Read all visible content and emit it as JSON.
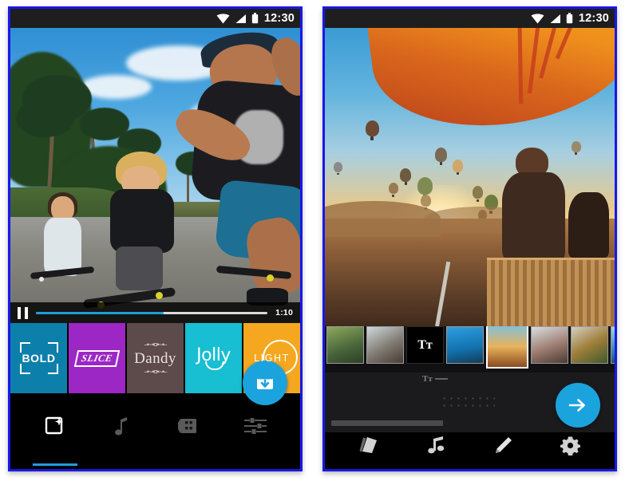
{
  "page": {
    "background": "#ffffff",
    "frame_border_color": "#1818e8",
    "accent_blue": "#1ba3dd"
  },
  "phones": [
    {
      "id": "left",
      "name": "video-editor-filters-screen",
      "status_bar": {
        "time": "12:30",
        "icons": [
          "wifi-icon",
          "signal-icon",
          "battery-icon"
        ]
      },
      "preview": {
        "name": "skateboarding-video-preview",
        "alt": "Man with cap filming a boy and woman on skateboards on a palm-lined road"
      },
      "player": {
        "state_icon": "pause-icon",
        "progress_percent": 55,
        "time_remaining": "1:10",
        "progress_color": "#1d9fdb",
        "track_color": "#d9d9d9"
      },
      "filters": [
        {
          "label": "BOLD",
          "color": "#0d7fab",
          "mark": "bracket-frame"
        },
        {
          "label": "SLICE",
          "color": "#9c27c4",
          "mark": "skew-box"
        },
        {
          "label": "Dandy",
          "color": "#5d4a4a",
          "mark": "ornament"
        },
        {
          "label": "Jolly",
          "color": "#18bed1",
          "mark": "smile"
        },
        {
          "label": "LIGHT",
          "color": "#f5a81f",
          "mark": "circle-ring"
        }
      ],
      "fab": {
        "icon": "save-to-box-icon",
        "color": "#1ba3dd"
      },
      "nav": [
        {
          "name": "nav-effects",
          "icon": "photo-sparkle-icon",
          "active": true
        },
        {
          "name": "nav-music",
          "icon": "music-note-icon",
          "active": false
        },
        {
          "name": "nav-clips",
          "icon": "film-strip-icon",
          "active": false
        },
        {
          "name": "nav-adjust",
          "icon": "sliders-icon",
          "active": false
        }
      ]
    },
    {
      "id": "right",
      "name": "story-timeline-editor-screen",
      "status_bar": {
        "time": "12:30",
        "icons": [
          "wifi-icon",
          "signal-icon",
          "battery-icon"
        ]
      },
      "preview": {
        "name": "hot-air-balloon-photo-preview",
        "alt": "Man in a hot air balloon basket at sunrise with balloons over valley"
      },
      "filmstrip": {
        "selected_index": 4,
        "thumbs": [
          {
            "name": "clip-thumb-1",
            "kind": "photo",
            "tone": "#6f7d4c"
          },
          {
            "name": "clip-thumb-2",
            "kind": "photo",
            "tone": "#8a9097"
          },
          {
            "name": "clip-thumb-3",
            "kind": "text",
            "label": "Tт"
          },
          {
            "name": "clip-thumb-4",
            "kind": "photo",
            "tone": "#1f7fc4"
          },
          {
            "name": "clip-thumb-5",
            "kind": "photo",
            "tone": "#c87b35"
          },
          {
            "name": "clip-thumb-6",
            "kind": "photo",
            "tone": "#a6a2a0"
          },
          {
            "name": "clip-thumb-7",
            "kind": "photo",
            "tone": "#8b7b3c"
          },
          {
            "name": "clip-thumb-8",
            "kind": "photo",
            "tone": "#3f82b0"
          },
          {
            "name": "clip-thumb-9",
            "kind": "photo",
            "tone": "#7d9a73"
          }
        ]
      },
      "text_tool_label": "Tт",
      "fab": {
        "icon": "arrow-right-icon",
        "color": "#1ba3dd"
      },
      "nav": [
        {
          "name": "nav-gallery",
          "icon": "photo-stack-icon",
          "active": false
        },
        {
          "name": "nav-music",
          "icon": "music-notes-icon",
          "active": false
        },
        {
          "name": "nav-edit",
          "icon": "pencil-icon",
          "active": false
        },
        {
          "name": "nav-settings",
          "icon": "gear-icon",
          "active": false
        }
      ]
    }
  ]
}
